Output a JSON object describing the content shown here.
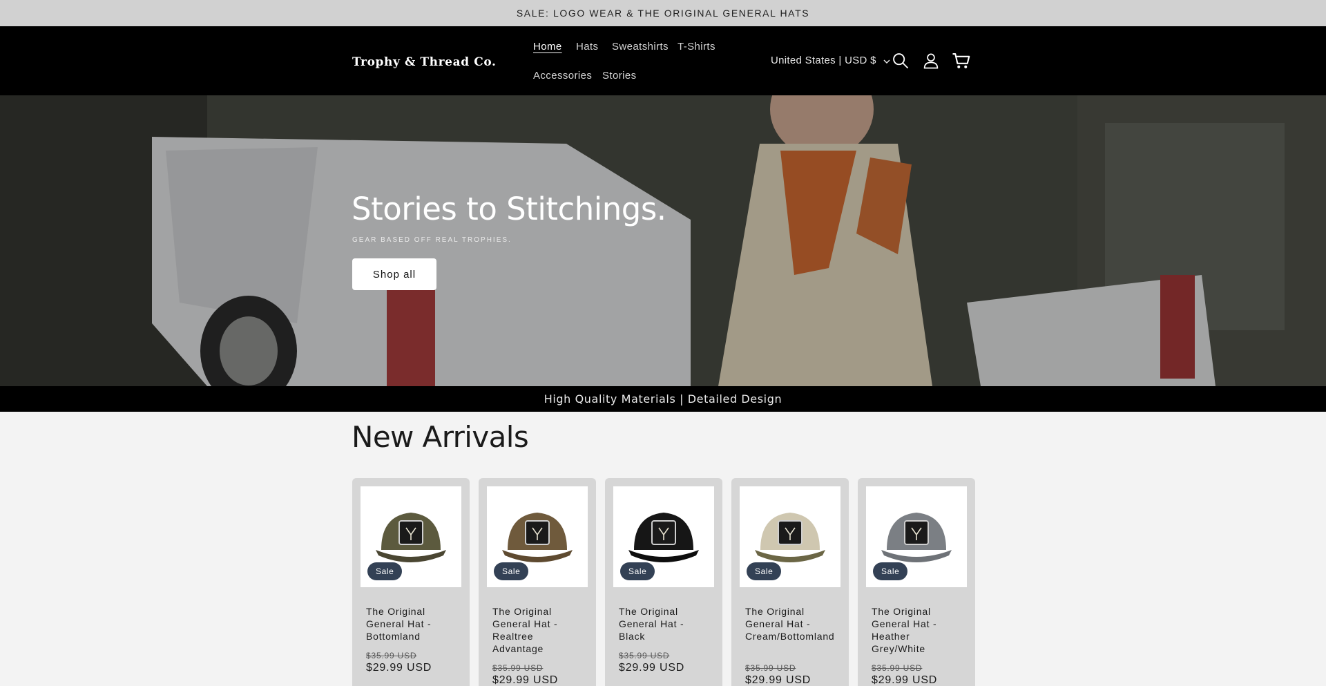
{
  "announcement": "SALE: LOGO WEAR & THE ORIGINAL GENERAL HATS",
  "header": {
    "logo": "Trophy & Thread Co.",
    "nav": [
      "Home",
      "Hats",
      "Sweatshirts",
      "T-Shirts",
      "Accessories",
      "Stories"
    ],
    "active_nav": "Home",
    "locale": "United States | USD $",
    "icons": [
      "search-icon",
      "account-icon",
      "cart-icon"
    ]
  },
  "hero": {
    "title": "Stories to Stitchings.",
    "subtitle": "GEAR BASED OFF REAL TROPHIES.",
    "cta": "Shop all"
  },
  "strip": "High Quality Materials | Detailed Design",
  "new_arrivals": {
    "title": "New Arrivals",
    "products": [
      {
        "title": "The Original General Hat - Bottomland",
        "badge": "Sale",
        "price_old": "$35.99 USD",
        "price_new": "$29.99 USD",
        "hat_color": "#5c5a3e",
        "brim_color": "#4a4632"
      },
      {
        "title": "The Original General Hat - Realtree Advantage",
        "badge": "Sale",
        "price_old": "$35.99 USD",
        "price_new": "$29.99 USD",
        "hat_color": "#6f5a3c",
        "brim_color": "#5e4a30"
      },
      {
        "title": "The Original General Hat - Black",
        "badge": "Sale",
        "price_old": "$35.99 USD",
        "price_new": "$29.99 USD",
        "hat_color": "#161616",
        "brim_color": "#0e0e0e"
      },
      {
        "title": "The Original General Hat - Cream/Bottomland",
        "badge": "Sale",
        "price_old": "$35.99 USD",
        "price_new": "$29.99 USD",
        "hat_color": "#cfc7b0",
        "brim_color": "#6b6645"
      },
      {
        "title": "The Original General Hat - Heather Grey/White",
        "badge": "Sale",
        "price_old": "$35.99 USD",
        "price_new": "$29.99 USD",
        "hat_color": "#7b7f84",
        "brim_color": "#6e7277"
      }
    ]
  }
}
